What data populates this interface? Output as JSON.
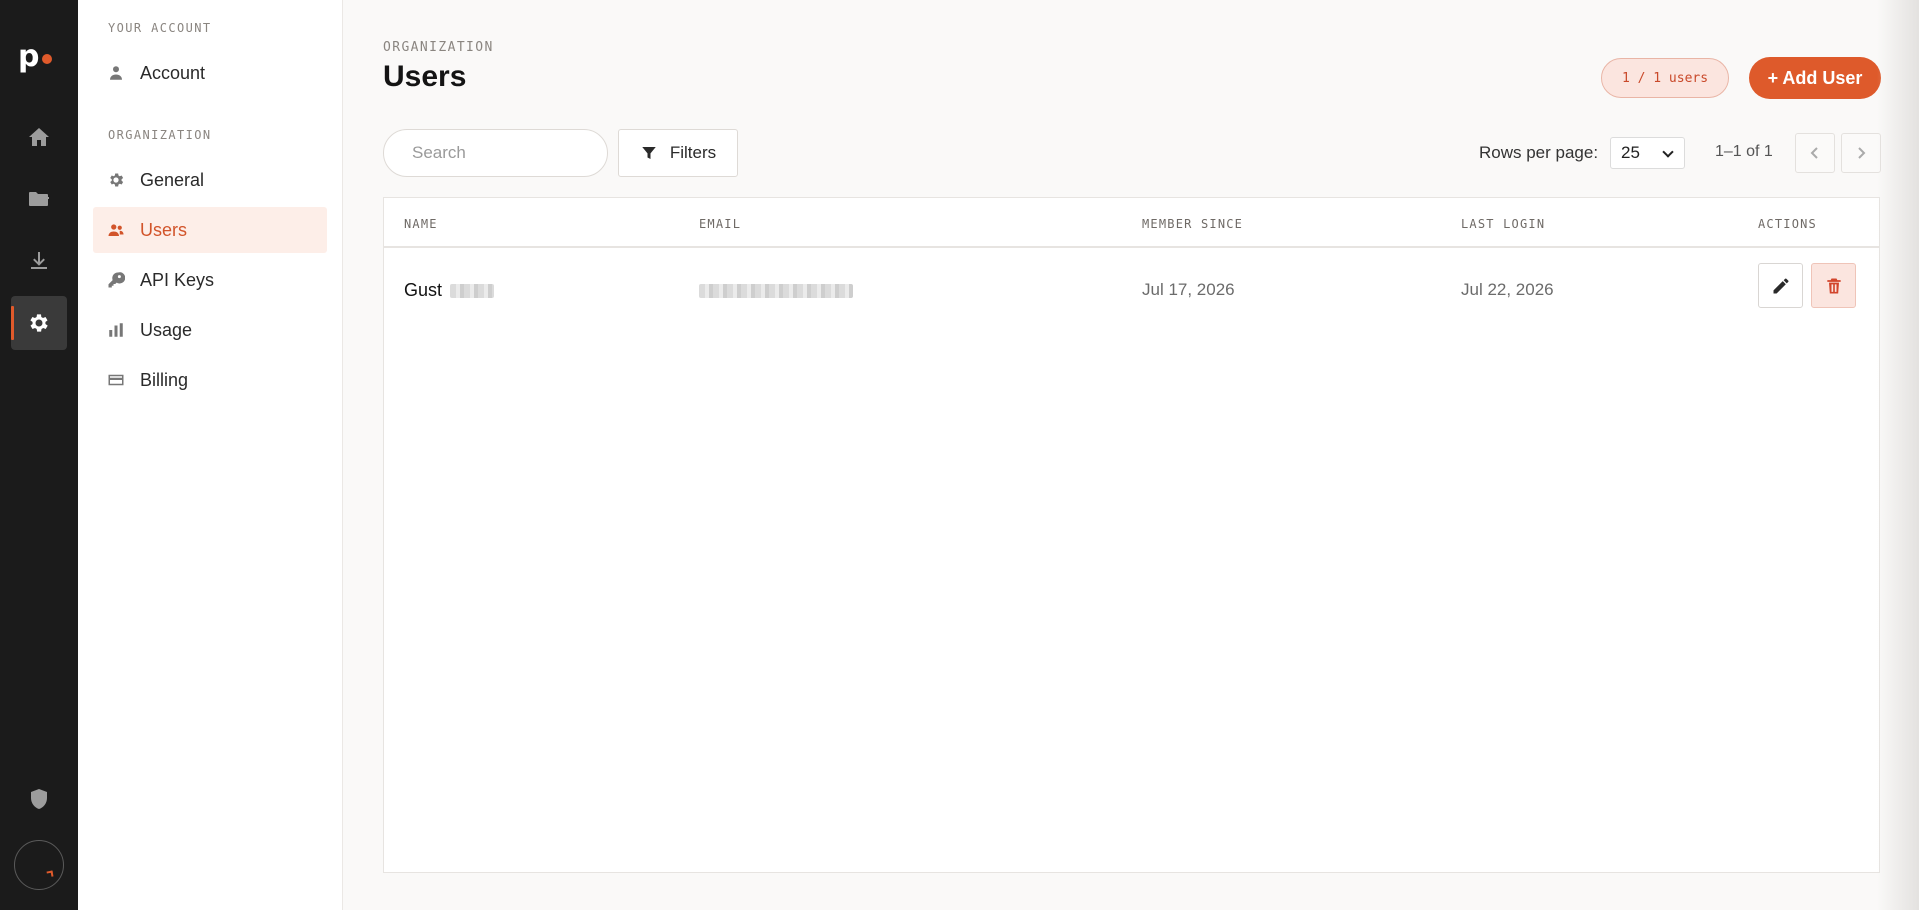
{
  "rail": {
    "logo_text": "p",
    "items": [
      {
        "icon": "home-icon"
      },
      {
        "icon": "folder-icon"
      },
      {
        "icon": "download-icon"
      },
      {
        "icon": "gear-icon",
        "active": true
      }
    ],
    "bottom": [
      {
        "icon": "shield-icon"
      },
      {
        "icon": "avatar"
      }
    ]
  },
  "sidebar": {
    "section_account": "YOUR ACCOUNT",
    "account_item": "Account",
    "section_org": "ORGANIZATION",
    "items": [
      {
        "label": "General",
        "icon": "gear-icon"
      },
      {
        "label": "Users",
        "icon": "users-icon",
        "active": true
      },
      {
        "label": "API Keys",
        "icon": "key-icon"
      },
      {
        "label": "Usage",
        "icon": "bar-chart-icon"
      },
      {
        "label": "Billing",
        "icon": "credit-card-icon"
      }
    ]
  },
  "header": {
    "breadcrumb": "ORGANIZATION",
    "title": "Users",
    "count_badge": "1 / 1 users",
    "add_button": "+ Add User"
  },
  "toolbar": {
    "search_placeholder": "Search",
    "filters_label": "Filters",
    "rows_per_page_label": "Rows per page:",
    "rows_per_page_value": "25",
    "range_text": "1–1 of 1"
  },
  "table": {
    "columns": [
      "NAME",
      "EMAIL",
      "MEMBER SINCE",
      "LAST LOGIN",
      "ACTIONS"
    ],
    "rows": [
      {
        "name": "Gust",
        "email": "",
        "member_since": "Jul 17, 2026",
        "last_login": "Jul 22, 2026"
      }
    ]
  },
  "colors": {
    "accent": "#de5a2b",
    "rail_bg": "#1b1b1b",
    "active_bg": "#fdeee8"
  }
}
